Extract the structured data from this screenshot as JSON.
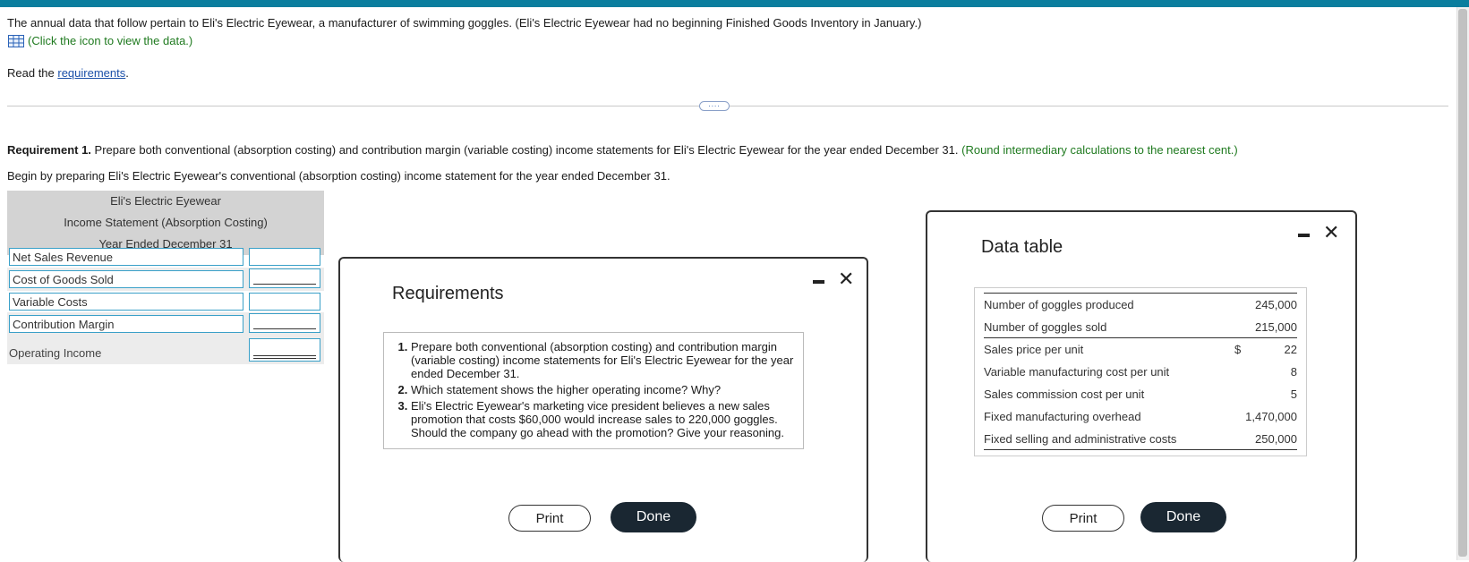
{
  "intro": "The annual data that follow pertain to Eli's Electric Eyewear, a manufacturer of swimming goggles. (Eli's Electric Eyewear had no beginning Finished Goods Inventory in January.)",
  "data_link": "(Click the icon to view the data.)",
  "read_prefix": "Read the ",
  "read_link": "requirements",
  "read_suffix": ".",
  "expander_label": "....",
  "requirement1": {
    "bold": "Requirement 1.",
    "text": " Prepare both conventional (absorption costing) and contribution margin (variable costing) income statements for Eli's Electric Eyewear for the year ended December 31. ",
    "note": "(Round intermediary calculations to the nearest cent.)"
  },
  "begin": "Begin by preparing Eli's Electric Eyewear's conventional (absorption costing) income statement for the year ended December 31.",
  "statement": {
    "company": "Eli's Electric Eyewear",
    "title": "Income Statement (Absorption Costing)",
    "period": "Year Ended December 31",
    "rows": [
      "Net Sales Revenue",
      "Cost of Goods Sold",
      "Variable Costs",
      "Contribution Margin",
      "Operating Income"
    ]
  },
  "requirements_modal": {
    "title": "Requirements",
    "items": [
      "Prepare both conventional (absorption costing) and contribution margin (variable costing) income statements for Eli's Electric Eyewear for the year ended December 31.",
      "Which statement shows the higher operating income? Why?",
      "Eli's Electric Eyewear's marketing vice president believes a new sales promotion that costs $60,000 would increase sales to 220,000 goggles. Should the company go ahead with the promotion? Give your reasoning."
    ],
    "print": "Print",
    "done": "Done"
  },
  "data_modal": {
    "title": "Data table",
    "rows": [
      {
        "label": "Number of goggles produced",
        "currency": "",
        "value": "245,000"
      },
      {
        "label": "Number of goggles sold",
        "currency": "",
        "value": "215,000"
      },
      {
        "label": "Sales price per unit",
        "currency": "$",
        "value": "22"
      },
      {
        "label": "Variable manufacturing cost per unit",
        "currency": "",
        "value": "8"
      },
      {
        "label": "Sales commission cost per unit",
        "currency": "",
        "value": "5"
      },
      {
        "label": "Fixed manufacturing overhead",
        "currency": "",
        "value": "1,470,000"
      },
      {
        "label": "Fixed selling and administrative costs",
        "currency": "",
        "value": "250,000"
      }
    ],
    "print": "Print",
    "done": "Done"
  },
  "colors": {
    "topbar": "#0b7e9e",
    "link_green": "#1f7a1f",
    "link_blue": "#1a4fa8",
    "done_bg": "#1a2732"
  }
}
